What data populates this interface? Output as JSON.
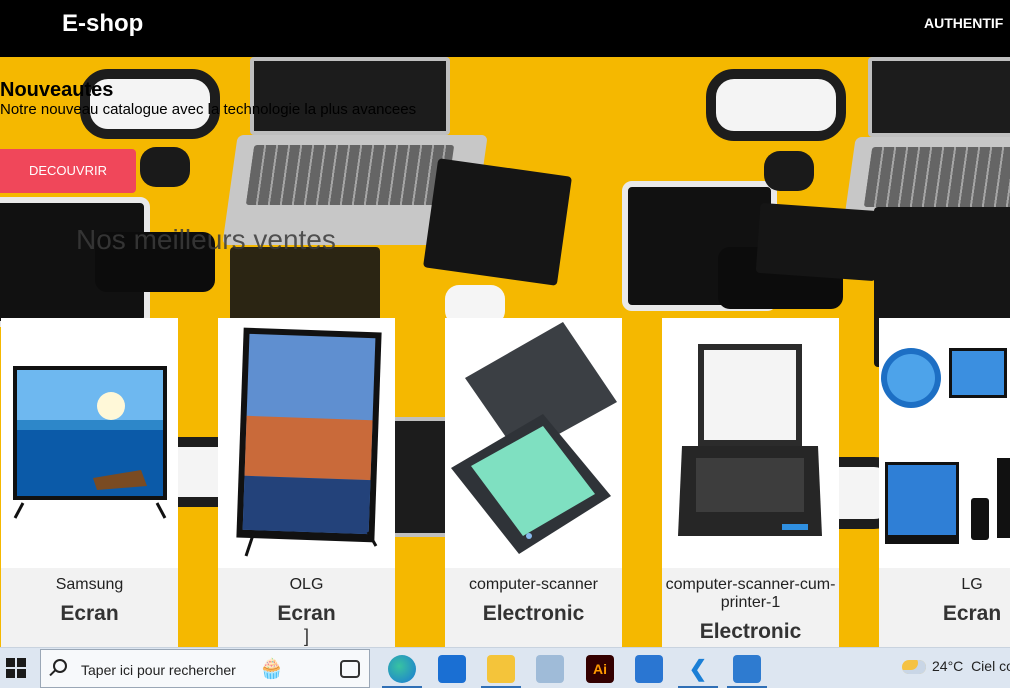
{
  "header": {
    "brand": "E-shop",
    "auth_label": "AUTHENTIF"
  },
  "hero": {
    "title": "Nouveautes",
    "subtitle": "Notre nouveau catalogue avec la technologie la plus avancees",
    "button_label": "DECOUVRIR",
    "section_title": "Nos meilleurs ventes"
  },
  "products": [
    {
      "brand": "Samsung",
      "category": "Ecran",
      "extra": ""
    },
    {
      "brand": "OLG",
      "category": "Ecran",
      "extra": "]"
    },
    {
      "brand": "computer-scanner",
      "category": "Electronic",
      "extra": ""
    },
    {
      "brand": "computer-scanner-cum-printer-1",
      "category": "Electronic",
      "extra": ""
    },
    {
      "brand": "LG",
      "category": "Ecran",
      "extra": ""
    }
  ],
  "taskbar": {
    "search_placeholder": "Taper ici pour rechercher",
    "weather_temp": "24°C",
    "weather_desc": "Ciel co",
    "apps": [
      "task-view",
      "edge",
      "mail",
      "file-explorer",
      "control-panel",
      "illustrator",
      "store",
      "vscode",
      "photos"
    ]
  },
  "colors": {
    "header_bg": "#000000",
    "accent_button": "#f0475a",
    "background_yellow": "#f4b600",
    "taskbar_bg": "#dde6f1"
  }
}
